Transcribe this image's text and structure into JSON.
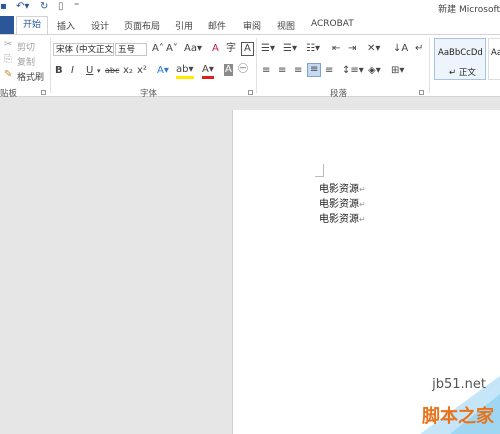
{
  "titlebar": {
    "doc_title": "新建 Microsoft"
  },
  "tabs": [
    "开始",
    "插入",
    "设计",
    "页面布局",
    "引用",
    "邮件",
    "审阅",
    "视图",
    "ACROBAT"
  ],
  "clipboard": {
    "cut": "剪切",
    "copy": "复制",
    "format_painter": "格式刷",
    "group_label": "贴板"
  },
  "font": {
    "name": "宋体 (中文正文",
    "size": "五号",
    "group_label": "字体"
  },
  "paragraph": {
    "group_label": "段落"
  },
  "styles": {
    "sample": "AaBbCcDd",
    "name": "↵ 正文",
    "sample2": "AaBb"
  },
  "document": {
    "lines": [
      "电影资源",
      "电影资源",
      "电影资源"
    ],
    "paragraph_mark": "↵"
  },
  "watermark": {
    "url": "jb51.net",
    "name": "脚本之家"
  }
}
